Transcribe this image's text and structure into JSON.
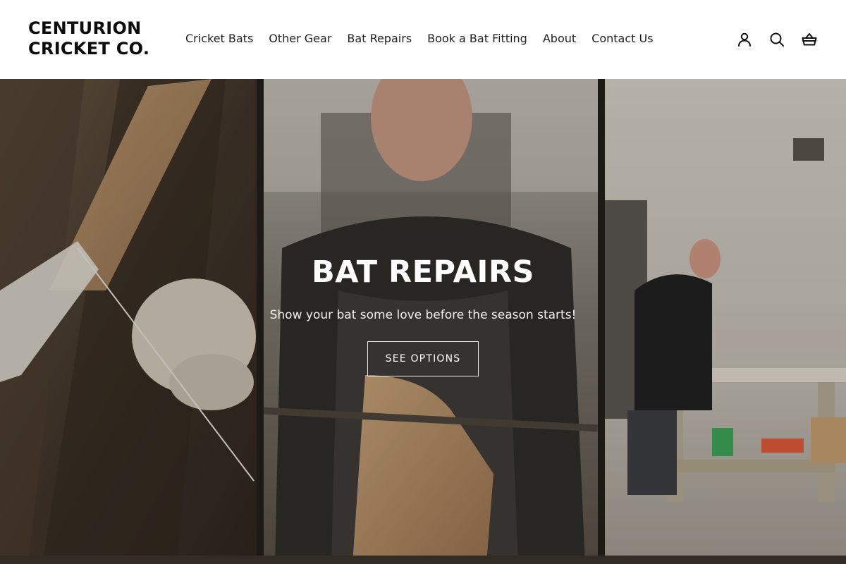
{
  "header": {
    "logo_line1": "CENTURION",
    "logo_line2": "CRICKET CO.",
    "nav": [
      {
        "label": "Cricket Bats"
      },
      {
        "label": "Other Gear"
      },
      {
        "label": "Bat Repairs"
      },
      {
        "label": "Book a Bat Fitting"
      },
      {
        "label": "About"
      },
      {
        "label": "Contact Us"
      }
    ],
    "icons": [
      "account-icon",
      "search-icon",
      "cart-basket-icon"
    ]
  },
  "hero": {
    "title": "BAT REPAIRS",
    "subtitle": "Show your bat some love before the season starts!",
    "button_label": "SEE OPTIONS"
  },
  "colors": {
    "text": "#111111",
    "header_bg": "#ffffff",
    "hero_overlay": "#14100c",
    "hero_text": "#ffffff"
  }
}
